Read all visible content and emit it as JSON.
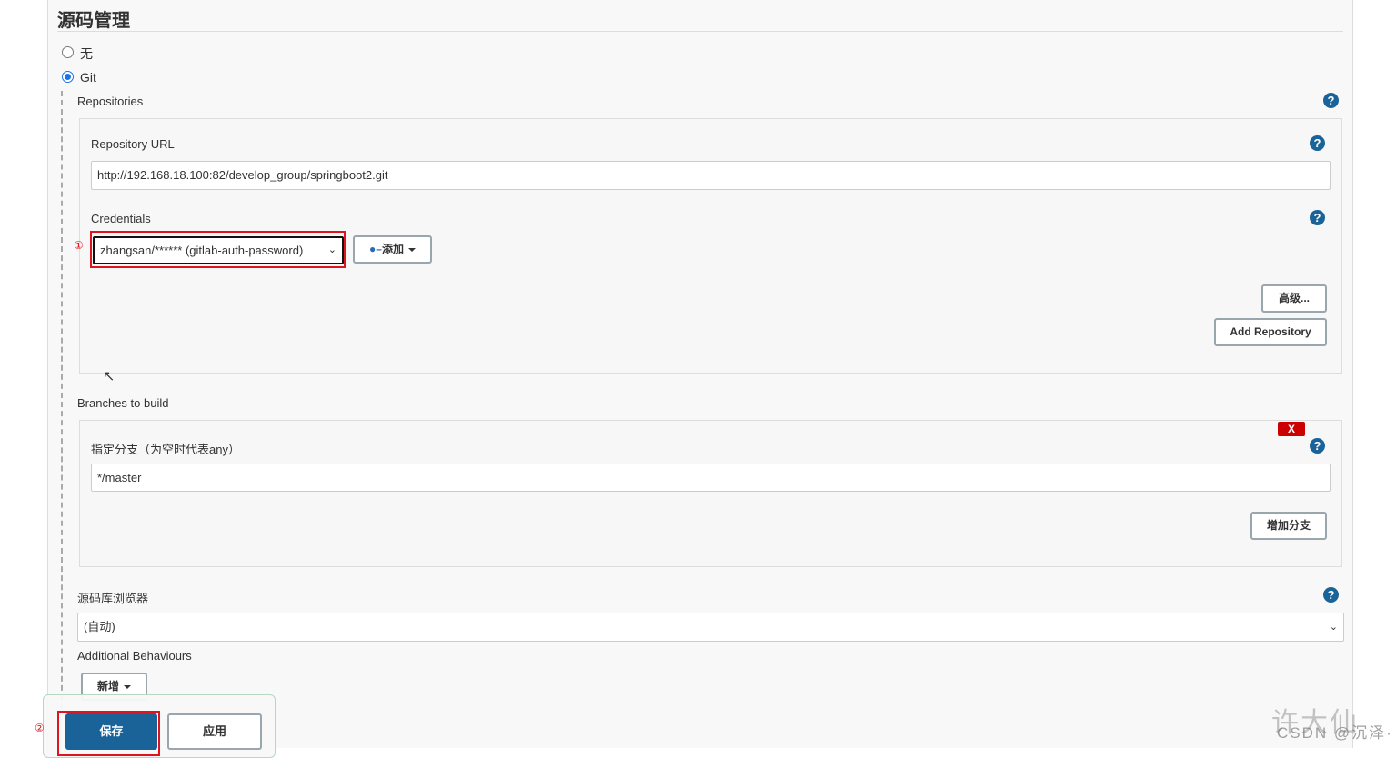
{
  "section_title": "源码管理",
  "scm_options": [
    {
      "label": "无",
      "selected": false
    },
    {
      "label": "Git",
      "selected": true
    }
  ],
  "repositories": {
    "label": "Repositories",
    "url_label": "Repository URL",
    "url_value": "http://192.168.18.100:82/develop_group/springboot2.git",
    "credentials_label": "Credentials",
    "credentials_value": "zhangsan/****** (gitlab-auth-password)",
    "add_label": "添加",
    "advanced_label": "高级...",
    "add_repository_label": "Add Repository"
  },
  "branches": {
    "label": "Branches to build",
    "branch_label": "指定分支（为空时代表any）",
    "branch_value": "*/master",
    "delete_label": "X",
    "add_branch_label": "增加分支"
  },
  "browser": {
    "label": "源码库浏览器",
    "value": "(自动)"
  },
  "behaviours": {
    "label": "Additional Behaviours",
    "add_label": "新增"
  },
  "footer": {
    "save_label": "保存",
    "apply_label": "应用"
  },
  "annotations": {
    "one": "①",
    "two": "②"
  },
  "watermark": "许大仙 CSDN @沉泽·",
  "colors": {
    "primary": "#1a6398",
    "highlight": "#e0141e",
    "delete": "#cc0000"
  }
}
